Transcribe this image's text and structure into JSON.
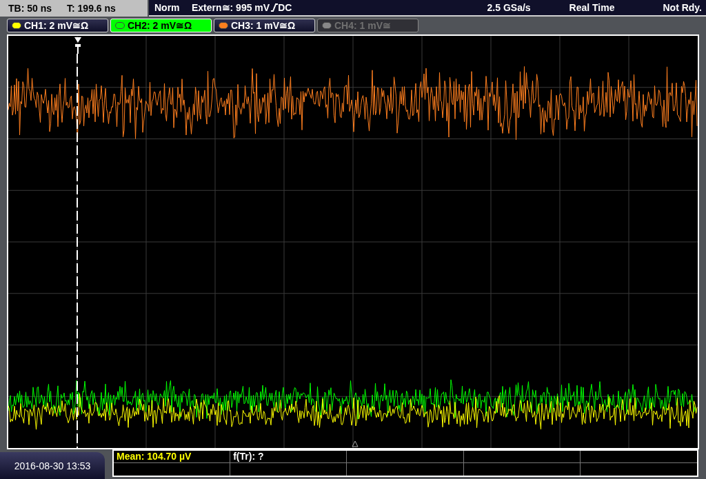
{
  "status_bar": {
    "timebase": "TB: 50 ns",
    "trigger_time": "T: 199.6 ns",
    "mode": "Norm",
    "trigger_source": "Extern≅: 995 mV",
    "trigger_coupling": "DC",
    "sample_rate": "2.5 GSa/s",
    "acquisition": "Real Time",
    "state": "Not Rdy."
  },
  "channels": [
    {
      "label": "CH1: 2 mV≅Ω",
      "color": "#ffff00",
      "selected": false,
      "disabled": false
    },
    {
      "label": "CH2: 2 mV≅Ω",
      "color": "#00ff00",
      "selected": true,
      "disabled": false
    },
    {
      "label": "CH3: 1 mV≅Ω",
      "color": "#ff7f1f",
      "selected": false,
      "disabled": false
    },
    {
      "label": "CH4: 1 mV≅",
      "color": "#888888",
      "selected": false,
      "disabled": true
    }
  ],
  "datetime": "2016-08-30 13:53",
  "measurements": [
    {
      "text": "Mean: 104.70 µV",
      "color": "#ffff00"
    },
    {
      "text": "f(Tr): ?",
      "color": "#ffffff"
    }
  ]
}
